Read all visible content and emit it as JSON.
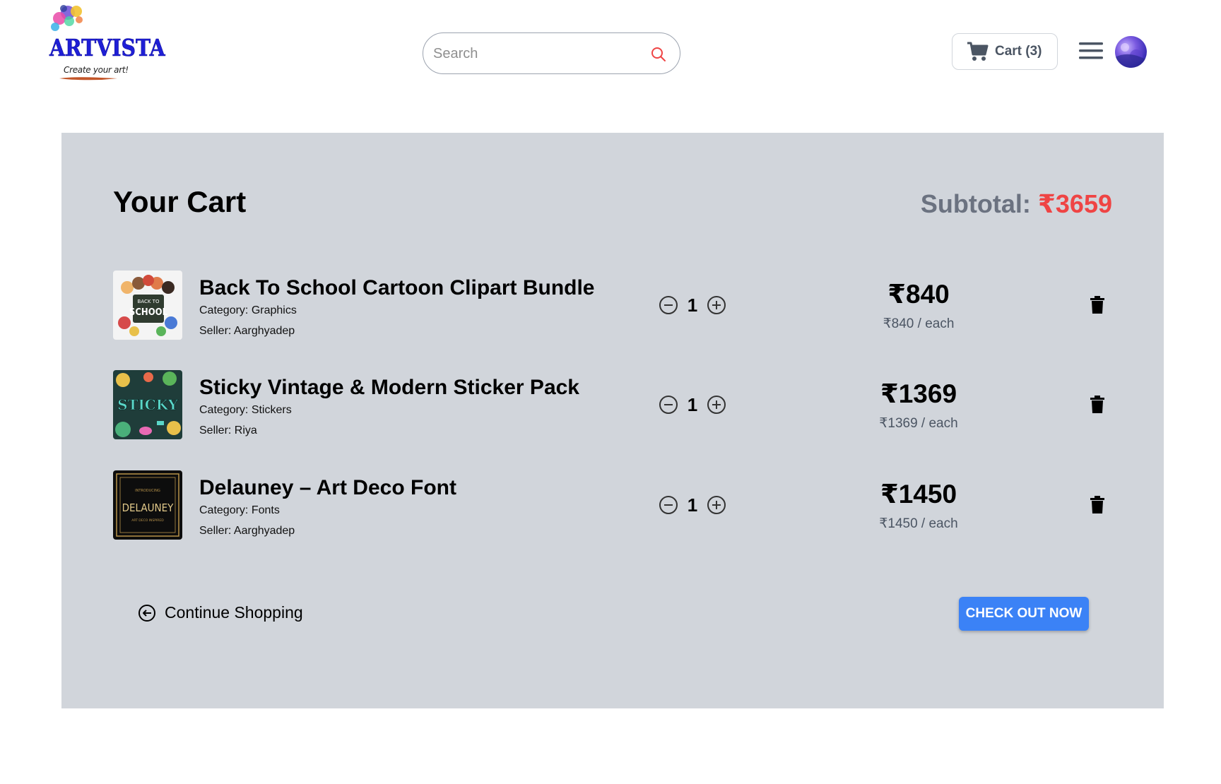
{
  "brand": {
    "name": "ARTVISTA",
    "tagline": "Create your art!"
  },
  "search": {
    "placeholder": "Search"
  },
  "header": {
    "cart_label": "Cart (3)"
  },
  "cart": {
    "title": "Your Cart",
    "subtotal_label": "Subtotal: ",
    "subtotal_value": "₹3659",
    "items": [
      {
        "name": "Back To School Cartoon Clipart Bundle",
        "category": "Category: Graphics",
        "seller": "Seller: Aarghyadep",
        "quantity": "1",
        "price": "₹840",
        "price_each": "₹840 / each"
      },
      {
        "name": "Sticky Vintage & Modern Sticker Pack",
        "category": "Category: Stickers",
        "seller": "Seller: Riya",
        "quantity": "1",
        "price": "₹1369",
        "price_each": "₹1369 / each"
      },
      {
        "name": "Delauney – Art Deco Font",
        "category": "Category: Fonts",
        "seller": "Seller: Aarghyadep",
        "quantity": "1",
        "price": "₹1450",
        "price_each": "₹1450 / each"
      }
    ],
    "continue_label": "Continue Shopping",
    "checkout_label": "CHECK OUT NOW"
  },
  "thumbs": {
    "school_text": "SCHOOL",
    "school_small": "BACK TO",
    "sticky_text": "STICKY",
    "delauney_text": "DELAUNEY",
    "delauney_top": "INTRODUCING",
    "delauney_bottom": "ART DECO INSPIRED"
  },
  "colors": {
    "accent": "#3b82f6",
    "subtotal": "#ef4444",
    "panel": "#d1d5db",
    "brand": "#1f1fd6"
  },
  "icons": [
    "search-icon",
    "cart-icon",
    "hamburger-menu-icon",
    "minus-circle-icon",
    "plus-circle-icon",
    "trash-icon",
    "arrow-left-circle-icon"
  ]
}
